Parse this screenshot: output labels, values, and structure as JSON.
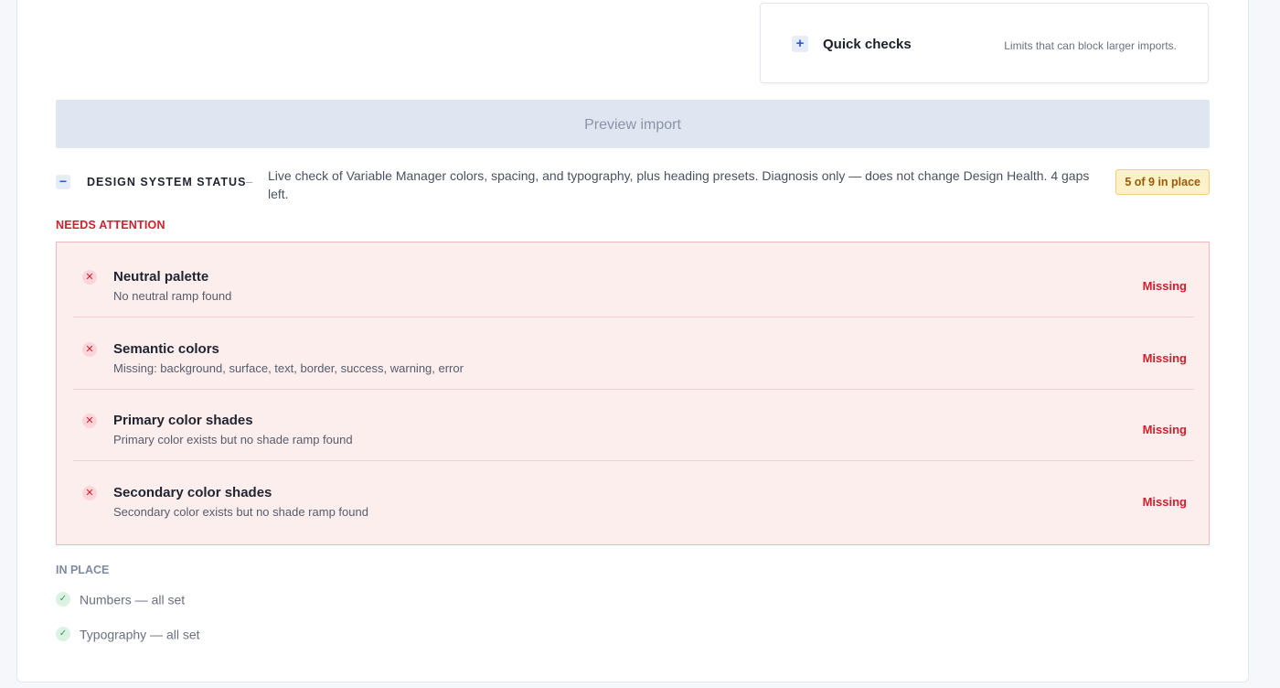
{
  "quick_checks": {
    "icon": "plus-icon",
    "title": "Quick checks",
    "subtitle": "Limits that can block larger imports."
  },
  "preview_button": {
    "label": "Preview import"
  },
  "design_system": {
    "icon": "minus-icon",
    "label": "DESIGN SYSTEM STATUS",
    "separator": "–",
    "description": "Live check of Variable Manager colors, spacing, and typography, plus heading presets. Diagnosis only — does not change Design Health. 4 gaps left.",
    "badge": "5 of 9 in place"
  },
  "needs_attention": {
    "label": "NEEDS ATTENTION",
    "items": [
      {
        "title": "Neutral palette",
        "detail": "No neutral ramp found",
        "status": "Missing"
      },
      {
        "title": "Semantic colors",
        "detail": "Missing: background, surface, text, border, success, warning, error",
        "status": "Missing"
      },
      {
        "title": "Primary color shades",
        "detail": "Primary color exists but no shade ramp found",
        "status": "Missing"
      },
      {
        "title": "Secondary color shades",
        "detail": "Secondary color exists but no shade ramp found",
        "status": "Missing"
      }
    ]
  },
  "in_place": {
    "label": "IN PLACE",
    "items": [
      {
        "text": "Numbers — all set"
      },
      {
        "text": "Typography — all set"
      }
    ]
  },
  "colors": {
    "accent": "#2d5bd0",
    "error": "#d11f2c",
    "warning_badge_bg": "#fdf2c7",
    "success": "#2f9a5a"
  }
}
